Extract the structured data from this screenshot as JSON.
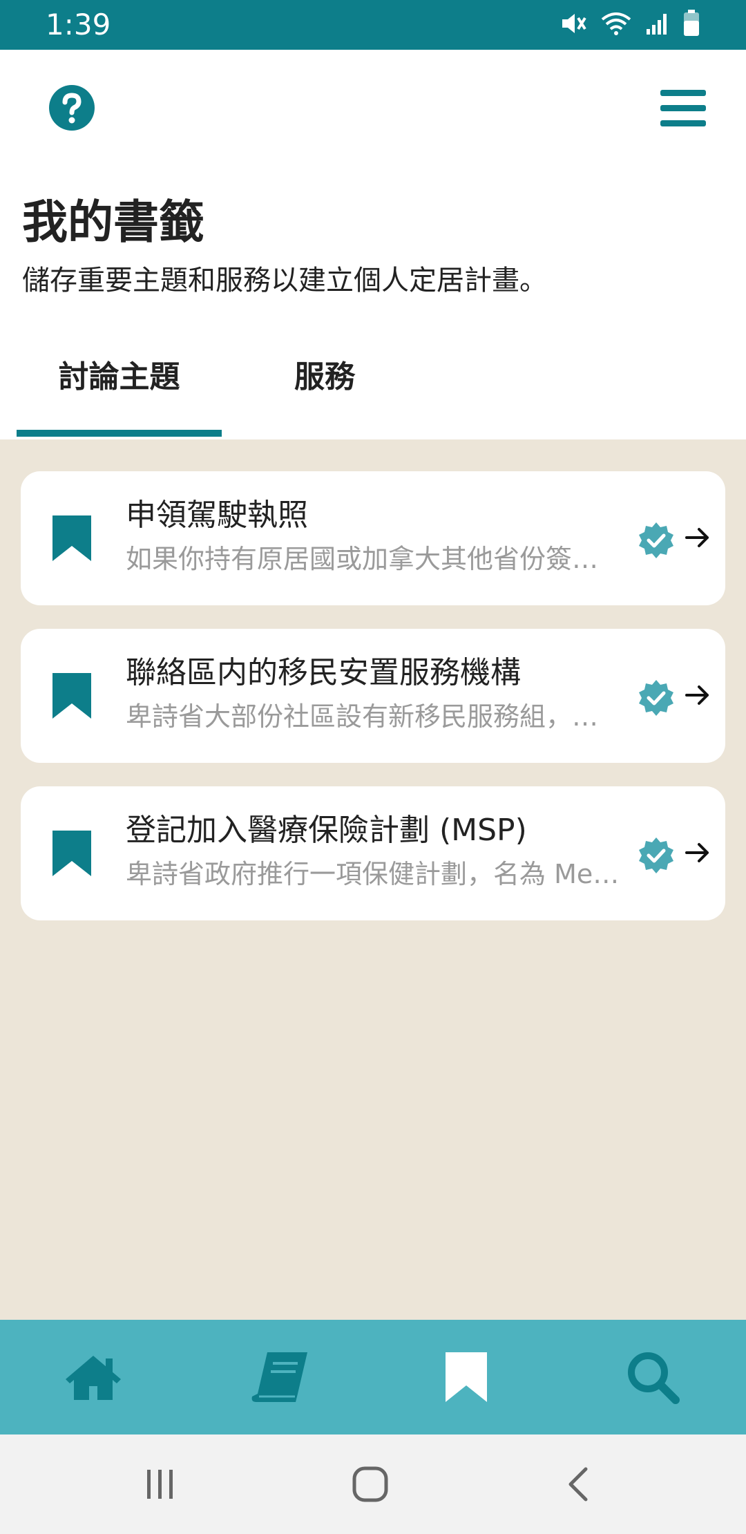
{
  "status_bar": {
    "time": "1:39",
    "icons": [
      "mute-icon",
      "wifi-icon",
      "signal-icon",
      "battery-icon"
    ]
  },
  "header": {
    "help_icon": "question-circle-icon",
    "menu_icon": "hamburger-menu-icon",
    "title": "我的書籤",
    "subtitle": "儲存重要主題和服務以建立個人定居計畫。",
    "tabs": [
      {
        "label": "討論主題",
        "active": true
      },
      {
        "label": "服務",
        "active": false
      }
    ]
  },
  "bookmarks": [
    {
      "title": "申領駕駛執照",
      "description": "如果你持有原居國或加拿大其他省份簽…",
      "icon": "bookmark-icon",
      "status_icon": "verified-badge-icon",
      "action_icon": "arrow-right-icon"
    },
    {
      "title": "聯絡區内的移民安置服務機構",
      "description": "卑詩省大部份社區設有新移民服務組，…",
      "icon": "bookmark-icon",
      "status_icon": "verified-badge-icon",
      "action_icon": "arrow-right-icon"
    },
    {
      "title": "登記加入醫療保險計劃 (MSP)",
      "description": "卑詩省政府推行一項保健計劃，名為 Me…",
      "icon": "bookmark-icon",
      "status_icon": "verified-badge-icon",
      "action_icon": "arrow-right-icon"
    }
  ],
  "bottom_nav": {
    "items": [
      {
        "icon": "home-icon",
        "active": false
      },
      {
        "icon": "book-icon",
        "active": false
      },
      {
        "icon": "bookmark-icon",
        "active": true
      },
      {
        "icon": "search-icon",
        "active": false
      }
    ]
  },
  "system_nav": [
    "recent-apps-icon",
    "home-circle-icon",
    "back-icon"
  ],
  "colors": {
    "primary": "#0d7e8a",
    "nav_background": "#4db3bf",
    "content_background": "#ece5d8",
    "badge": "#4aa8b4"
  }
}
